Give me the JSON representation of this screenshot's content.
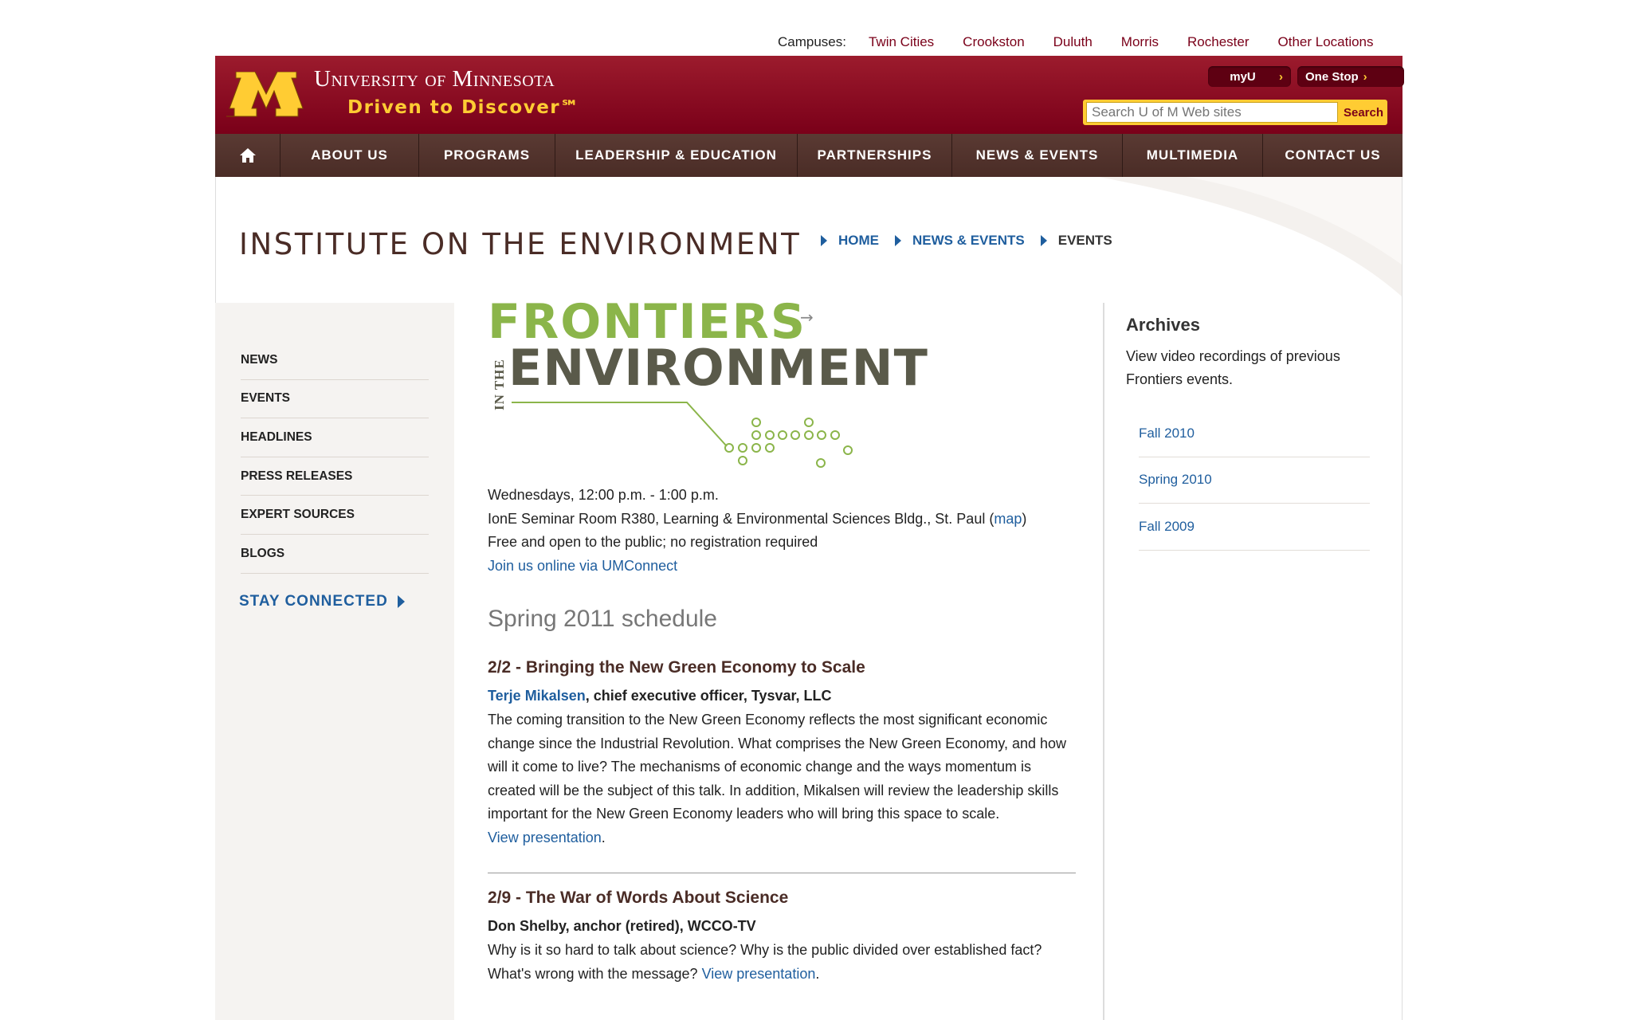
{
  "campus_bar": {
    "label": "Campuses:",
    "links": [
      "Twin Cities",
      "Crookston",
      "Duluth",
      "Morris",
      "Rochester",
      "Other Locations"
    ]
  },
  "header": {
    "university_name": "University of Minnesota",
    "tagline": "Driven to Discover℠",
    "myu_label": "myU",
    "onestop_label": "One Stop",
    "search_placeholder": "Search U of M Web sites",
    "search_button": "Search",
    "colors": {
      "maroon": "#7a0019",
      "gold": "#ffcc33"
    }
  },
  "nav": {
    "home_icon": "home-icon",
    "items": [
      "ABOUT US",
      "PROGRAMS",
      "LEADERSHIP & EDUCATION",
      "PARTNERSHIPS",
      "NEWS & EVENTS",
      "MULTIMEDIA",
      "CONTACT US"
    ]
  },
  "site_title": "INSTITUTE ON THE ENVIRONMENT",
  "breadcrumb": {
    "home": "HOME",
    "news_events": "NEWS & EVENTS",
    "current": "EVENTS"
  },
  "sidebar": {
    "items": [
      "NEWS",
      "EVENTS",
      "HEADLINES",
      "PRESS RELEASES",
      "EXPERT SOURCES",
      "BLOGS"
    ],
    "stay_connected": "STAY CONNECTED"
  },
  "banner": {
    "line1": "FRONTIERS",
    "line2_small": "IN THE",
    "line3": "ENVIRONMENT"
  },
  "event_info": {
    "time": "Wednesdays, 12:00 p.m. - 1:00 p.m.",
    "location_prefix": "IonE Seminar Room R380, Learning & Environmental Sciences Bldg., St. Paul (",
    "location_link": "map",
    "location_suffix": ")",
    "admission": "Free and open to the public; no registration required",
    "online_link": "Join us online via UMConnect"
  },
  "schedule_heading": "Spring 2011 schedule",
  "events": [
    {
      "title": "2/2 - Bringing the New Green Economy to Scale",
      "speaker_link": "Terje Mikalsen",
      "speaker_rest": ", chief executive officer, Tysvar, LLC",
      "body": "The coming transition to the New Green Economy reflects the most significant economic change since the Industrial Revolution. What comprises the New Green Economy, and how will it come to live?  The mechanisms of economic change and the ways momentum is created will be the subject of this talk. In addition, Mikalsen will review the leadership skills important for the New Green Economy leaders who will bring this space to scale.",
      "link": "View presentation",
      "link_suffix": "."
    },
    {
      "title": "2/9 - The War of Words About Science",
      "speaker": "Don Shelby, anchor (retired), WCCO-TV",
      "body": "Why is it so hard to talk about science?  Why is the public divided over established fact?  What's wrong with the message?",
      "link": "View presentation",
      "link_suffix": "."
    }
  ],
  "archives": {
    "title": "Archives",
    "description": "View video recordings of previous Frontiers events.",
    "links": [
      "Fall 2010",
      "Spring 2010",
      "Fall 2009"
    ]
  }
}
